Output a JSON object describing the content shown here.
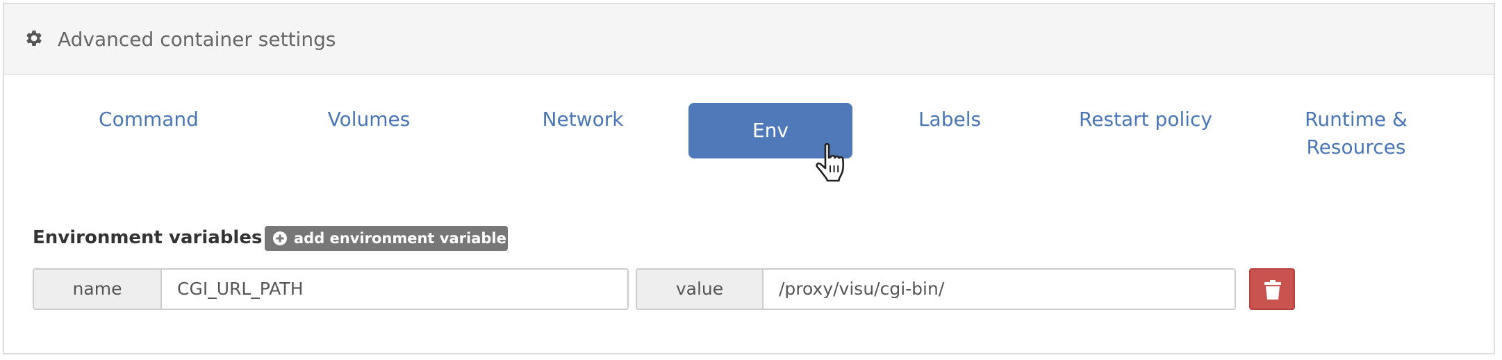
{
  "panel": {
    "title": "Advanced container settings",
    "icon": "gear-icon"
  },
  "tabs": [
    {
      "label": "Command",
      "active": false
    },
    {
      "label": "Volumes",
      "active": false
    },
    {
      "label": "Network",
      "active": false
    },
    {
      "label": "Env",
      "active": true
    },
    {
      "label": "Labels",
      "active": false
    },
    {
      "label": "Restart policy",
      "active": false
    },
    {
      "label": "Runtime & Resources",
      "label_line1": "Runtime &",
      "label_line2": "Resources",
      "active": false
    }
  ],
  "env": {
    "title": "Environment variables",
    "add_button_label": "add environment variable",
    "variables": [
      {
        "name_label": "name",
        "name": "CGI_URL_PATH",
        "value_label": "value",
        "value": "/proxy/visu/cgi-bin/"
      }
    ]
  },
  "colors": {
    "accent": "#4f79b8",
    "danger": "#c9534f",
    "header_bg": "#f5f5f5"
  }
}
